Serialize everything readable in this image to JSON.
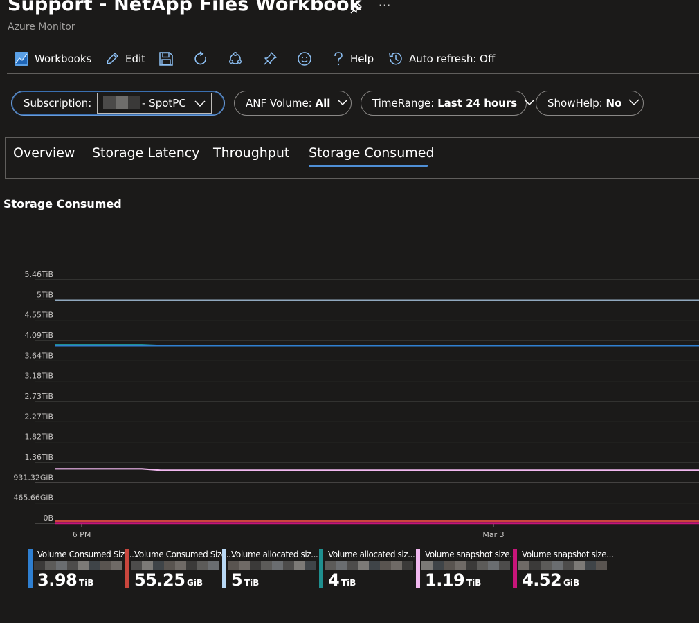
{
  "header": {
    "title": "Support - NetApp Files Workbook",
    "subtitle": "Azure Monitor",
    "more_label": "···"
  },
  "toolbar": {
    "workbooks_label": "Workbooks",
    "edit_label": "Edit",
    "help_label": "Help",
    "auto_refresh_label": "Auto refresh: Off"
  },
  "params": {
    "subscription_label": "Subscription:",
    "subscription_value": "- SpotPC",
    "volume_label": "ANF Volume:",
    "volume_value": "All",
    "timerange_label": "TimeRange:",
    "timerange_value": "Last 24 hours",
    "showhelp_label": "ShowHelp:",
    "showhelp_value": "No"
  },
  "tabs": [
    "Overview",
    "Storage Latency",
    "Throughput",
    "Storage Consumed"
  ],
  "active_tab": "Storage Consumed",
  "section_title": "Storage Consumed",
  "chart_data": {
    "type": "line",
    "title": "",
    "ytick_labels": [
      "0B",
      "465.66GiB",
      "931.32GiB",
      "1.36TiB",
      "1.82TiB",
      "2.27TiB",
      "2.73TiB",
      "3.18TiB",
      "3.64TiB",
      "4.09TiB",
      "4.55TiB",
      "5TiB",
      "5.46TiB"
    ],
    "ylim_tib": [
      0,
      5.46
    ],
    "xtick_labels": [
      "6 PM",
      "Mar 3"
    ],
    "grid": true,
    "series": [
      {
        "color": "#2f7fd0",
        "values_tib": [
          3.98,
          3.98,
          3.98,
          3.98
        ]
      },
      {
        "color": "#c9463d",
        "values_tib": [
          0.054,
          0.054,
          0.054,
          0.054
        ]
      },
      {
        "color": "#b8d8f5",
        "values_tib": [
          5,
          5,
          5,
          5
        ]
      },
      {
        "color": "#1f8f8f",
        "values_tib": [
          4,
          4,
          3.98,
          3.98
        ]
      },
      {
        "color": "#f1b8ef",
        "values_tib": [
          1.22,
          1.22,
          1.19,
          1.19
        ]
      },
      {
        "color": "#c8157a",
        "values_tib": [
          0.0044,
          0.0044,
          0.0044,
          0.0044
        ]
      }
    ]
  },
  "legend": [
    {
      "name": "Volume Consumed Size...",
      "value": "3.98",
      "unit": "TiB",
      "color": "#2f7fd0"
    },
    {
      "name": "Volume Consumed Size...",
      "value": "55.25",
      "unit": "GiB",
      "color": "#c9463d"
    },
    {
      "name": "Volume allocated siz...",
      "value": "5",
      "unit": "TiB",
      "color": "#b8d8f5"
    },
    {
      "name": "Volume allocated siz...",
      "value": "4",
      "unit": "TiB",
      "color": "#1f8f8f"
    },
    {
      "name": "Volume snapshot size...",
      "value": "1.19",
      "unit": "TiB",
      "color": "#f1b8ef"
    },
    {
      "name": "Volume snapshot size...",
      "value": "4.52",
      "unit": "GiB",
      "color": "#c8157a"
    }
  ],
  "icons": {
    "workbooks": "workbooks-icon",
    "edit": "pencil-icon",
    "save": "save-icon",
    "refresh": "refresh-icon",
    "share": "share-icon",
    "pin": "pin-icon",
    "feedback": "smiley-icon",
    "help": "help-icon",
    "auto_refresh": "history-icon"
  }
}
